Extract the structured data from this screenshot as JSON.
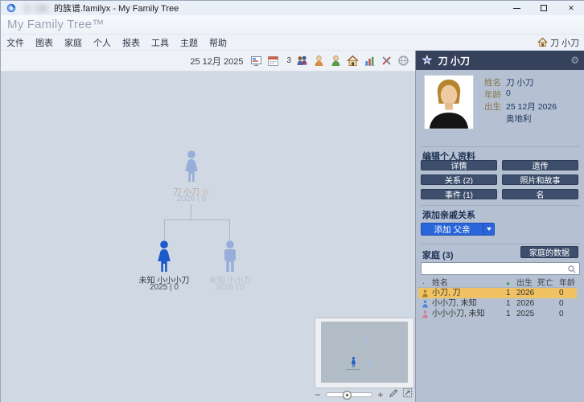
{
  "window": {
    "title": "的族谱.familyx - My Family Tree"
  },
  "app_header": {
    "title": "My Family Tree™"
  },
  "menu": {
    "items": [
      "文件",
      "图表",
      "家庭",
      "个人",
      "报表",
      "工具",
      "主题",
      "帮助"
    ],
    "home_person": "刀 小刀"
  },
  "toolbar": {
    "date": "25 12月 2025",
    "badge_count": "3",
    "icon_names": [
      "slideshow-icon",
      "calendar-icon",
      "group-icon",
      "add-female-icon",
      "add-person-icon",
      "home-icon",
      "statistics-icon",
      "tools-icon",
      "web-icon"
    ]
  },
  "canvas": {
    "tree": {
      "root": {
        "name": "刀 小刀",
        "star": "☆",
        "detail": "2026 | 0",
        "gender": "female"
      },
      "children": [
        {
          "name": "未知 小小小刀",
          "detail": "2025 | 0",
          "gender": "female",
          "selected": true
        },
        {
          "name": "未知 小小刀",
          "detail": "2026 | 0",
          "gender": "male",
          "selected": false
        }
      ]
    },
    "zoom": {
      "minus": "−",
      "plus": "+"
    }
  },
  "sidebar": {
    "header": {
      "name": "刀 小刀"
    },
    "profile": {
      "fields": [
        {
          "label": "姓名",
          "value": "刀 小刀"
        },
        {
          "label": "年龄",
          "value": "0"
        },
        {
          "label": "出生",
          "value": "25 12月 2026"
        },
        {
          "label": "",
          "value": "奥地利"
        }
      ]
    },
    "edit": {
      "title": "编辑个人资料",
      "buttons": [
        "详情",
        "遗传",
        "关系 (2)",
        "照片和故事",
        "事件 (1)",
        "名"
      ]
    },
    "add": {
      "title": "添加亲戚关系",
      "button_label": "添加 父亲"
    },
    "family": {
      "title": "家庭 (3)",
      "data_button": "家庭的数据",
      "search_value": "",
      "table": {
        "headers": [
          "姓名",
          "出生",
          "死亡",
          "年龄"
        ],
        "rows": [
          {
            "name": "小刀, 刀",
            "count": "1",
            "birth": "2026",
            "death": "",
            "age": "0",
            "selected": true
          },
          {
            "name": "小小刀, 未知",
            "count": "1",
            "birth": "2026",
            "death": "",
            "age": "0",
            "selected": false
          },
          {
            "name": "小小小刀, 未知",
            "count": "1",
            "birth": "2025",
            "death": "",
            "age": "0",
            "selected": false
          }
        ]
      }
    }
  },
  "icons": {
    "gear": "⚙",
    "header_star": "★",
    "green_dot": "●",
    "close": "✕"
  },
  "colors": {
    "accent_blue": "#2a65d9",
    "selection_orange": "#f1c263",
    "sidebar_header": "#36425c",
    "navy_button": "#3e4f6e",
    "canvas_bg": "#cfd8e3",
    "figure_light": "#96aed9",
    "figure_selected": "#1d59c9"
  }
}
